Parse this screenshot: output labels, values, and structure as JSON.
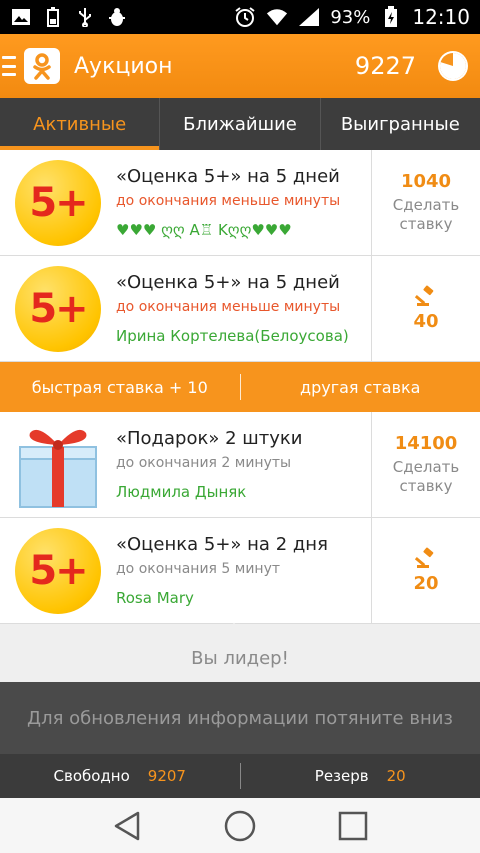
{
  "status_bar": {
    "battery": "93%",
    "time": "12:10",
    "icons": [
      "image-icon",
      "battery-saver-icon",
      "usb-icon",
      "debug-icon",
      "alarm-icon",
      "wifi-icon",
      "signal-icon",
      "battery-charging-icon"
    ]
  },
  "app_bar": {
    "title": "Аукцион",
    "balance": "9227",
    "icons": [
      "menu-icon",
      "ok-logo-icon",
      "timer-pie-icon"
    ]
  },
  "tabs": [
    {
      "label": "Активные",
      "active": true
    },
    {
      "label": "Ближайшие",
      "active": false
    },
    {
      "label": "Выигранные",
      "active": false
    }
  ],
  "lots": [
    {
      "badge": "5+",
      "title": "«Оценка 5+» на 5 дней",
      "time_left": "до окончания меньше минуты",
      "leader": "♥♥♥ ღღ A♖ Kღღ♥♥♥",
      "price": "1040",
      "action": "Сделать ставку"
    },
    {
      "badge": "5+",
      "title": "«Оценка 5+» на 5 дней",
      "time_left": "до окончания меньше минуты",
      "leader": "Ирина Кортелева(Белоусова)",
      "my_bid": "40"
    },
    {
      "title": "«Подарок» 2 штуки",
      "time_left": "до окончания 2 минуты",
      "leader": "Людмила Дыняк",
      "price": "14100",
      "action": "Сделать ставку"
    },
    {
      "badge": "5+",
      "title": "«Оценка 5+» на 2 дня",
      "time_left": "до окончания 5 минут",
      "leader": "Rosa Mary",
      "my_bid": "20"
    }
  ],
  "quick_actions": {
    "quick_bid": "быстрая ставка + 10",
    "other_bid": "другая ставка"
  },
  "leader_text": "Вы лидер!",
  "refresh_hint": "Для обновления информации потяните вниз",
  "balance_bar": {
    "free_label": "Свободно",
    "free_value": "9207",
    "reserve_label": "Резерв",
    "reserve_value": "20"
  },
  "colors": {
    "accent": "#f7941d",
    "leader_green": "#3aa835",
    "warning_red": "#e8572c",
    "tab_bg": "#3d3d3d"
  }
}
